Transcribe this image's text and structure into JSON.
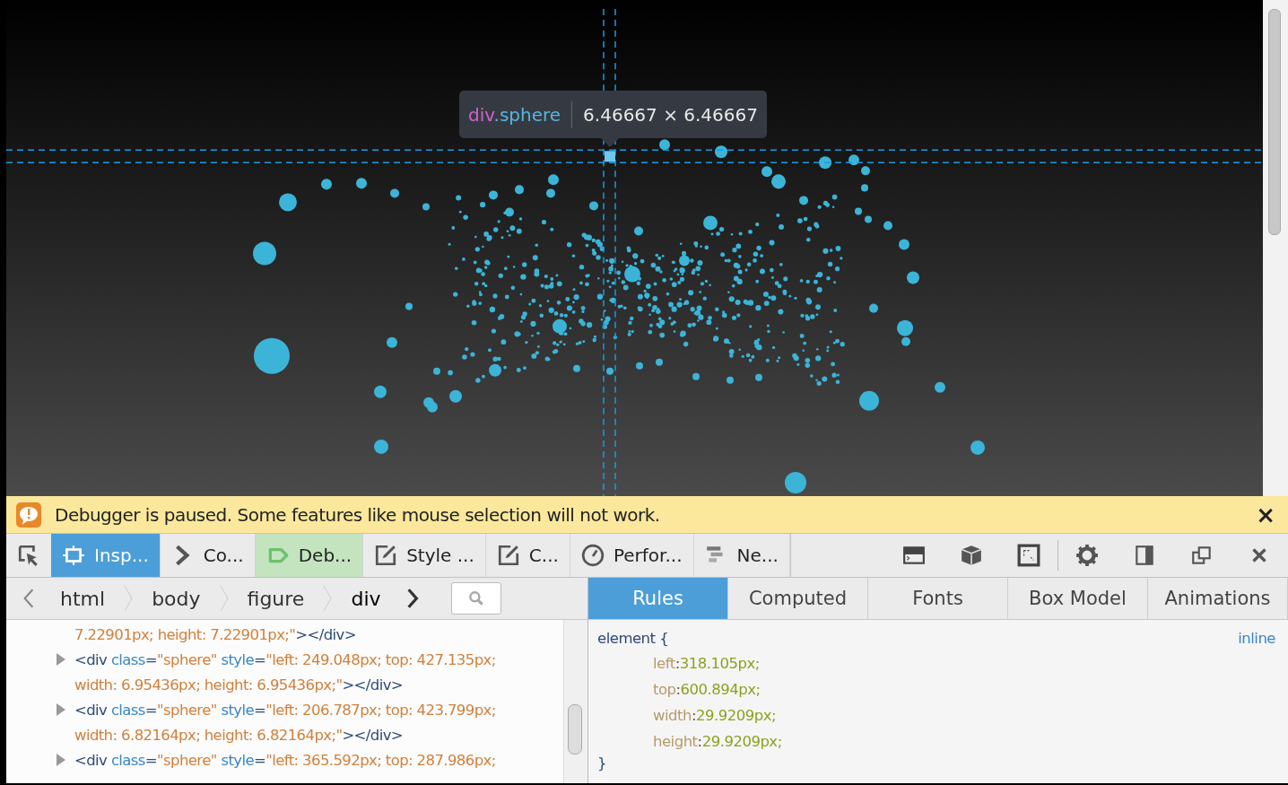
{
  "tooltip": {
    "tag": "div",
    "classes": ".sphere",
    "size": "6.46667 × 6.46667"
  },
  "notification": {
    "message": "Debugger is paused. Some features like mouse selection will not work.",
    "close": "×"
  },
  "toolbar": {
    "tabs": [
      {
        "kind": "inspector",
        "label": "Insp...",
        "selected": true,
        "paused": false
      },
      {
        "kind": "console",
        "label": "Co...",
        "selected": false,
        "paused": false
      },
      {
        "kind": "debugger",
        "label": "Deb...",
        "selected": false,
        "paused": true
      },
      {
        "kind": "style",
        "label": "Style ...",
        "selected": false,
        "paused": false
      },
      {
        "kind": "canvas",
        "label": "C...",
        "selected": false,
        "paused": false
      },
      {
        "kind": "performance",
        "label": "Perfor...",
        "selected": false,
        "paused": false
      },
      {
        "kind": "network",
        "label": "Ne...",
        "selected": false,
        "paused": false
      }
    ]
  },
  "breadcrumbs": [
    {
      "label": "html",
      "selected": false
    },
    {
      "label": "body",
      "selected": false
    },
    {
      "label": "figure",
      "selected": false
    },
    {
      "label": "div",
      "selected": true
    }
  ],
  "markup": [
    {
      "kind": "continuation",
      "lines": [
        [
          {
            "kind": "val",
            "t": "7.22901px; height: 7.22901px;\""
          },
          {
            "kind": "tag",
            "t": "></div>"
          }
        ]
      ]
    },
    {
      "kind": "element",
      "expanded": false,
      "lines": [
        [
          {
            "kind": "tag",
            "t": "<div"
          },
          {
            "kind": "attr",
            "t": " class"
          },
          {
            "kind": "tag",
            "t": "="
          },
          {
            "kind": "val",
            "t": "\"sphere\""
          },
          {
            "kind": "attr",
            "t": " style"
          },
          {
            "kind": "tag",
            "t": "="
          },
          {
            "kind": "val",
            "t": "\"left: 249.048px; top: 427.135px;"
          }
        ],
        [
          {
            "kind": "val",
            "t": "width: 6.95436px; height: 6.95436px;\""
          },
          {
            "kind": "tag",
            "t": "></div>"
          }
        ]
      ]
    },
    {
      "kind": "element",
      "expanded": false,
      "lines": [
        [
          {
            "kind": "tag",
            "t": "<div"
          },
          {
            "kind": "attr",
            "t": " class"
          },
          {
            "kind": "tag",
            "t": "="
          },
          {
            "kind": "val",
            "t": "\"sphere\""
          },
          {
            "kind": "attr",
            "t": " style"
          },
          {
            "kind": "tag",
            "t": "="
          },
          {
            "kind": "val",
            "t": "\"left: 206.787px; top: 423.799px;"
          }
        ],
        [
          {
            "kind": "val",
            "t": "width: 6.82164px; height: 6.82164px;\""
          },
          {
            "kind": "tag",
            "t": "></div>"
          }
        ]
      ]
    },
    {
      "kind": "element",
      "expanded": false,
      "lines": [
        [
          {
            "kind": "tag",
            "t": "<div"
          },
          {
            "kind": "attr",
            "t": " class"
          },
          {
            "kind": "tag",
            "t": "="
          },
          {
            "kind": "val",
            "t": "\"sphere\""
          },
          {
            "kind": "attr",
            "t": " style"
          },
          {
            "kind": "tag",
            "t": "="
          },
          {
            "kind": "val",
            "t": "\"left: 365.592px; top: 287.986px;"
          }
        ]
      ]
    }
  ],
  "sidebar_tabs": [
    {
      "label": "Rules",
      "selected": true
    },
    {
      "label": "Computed",
      "selected": false
    },
    {
      "label": "Fonts",
      "selected": false
    },
    {
      "label": "Box Model",
      "selected": false
    },
    {
      "label": "Animations",
      "selected": false
    }
  ],
  "rule": {
    "selector": "element {",
    "source": "inline",
    "properties": [
      {
        "name": "left",
        "colon": ":",
        "value": "318.105px;"
      },
      {
        "name": "top",
        "colon": ":",
        "value": "600.894px;"
      },
      {
        "name": "width",
        "colon": ":",
        "value": "29.9209px;"
      },
      {
        "name": "height",
        "colon": ":",
        "value": "29.9209px;"
      }
    ],
    "close": "}"
  }
}
